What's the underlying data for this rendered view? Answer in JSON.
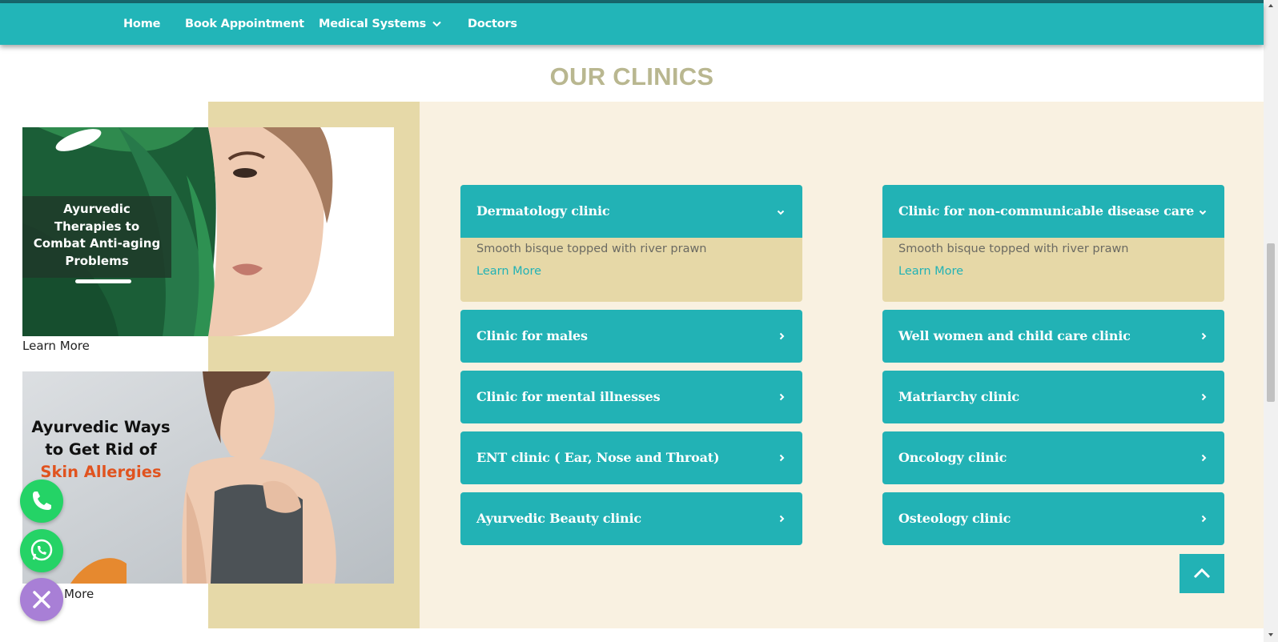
{
  "nav": {
    "items": [
      {
        "label": "Home"
      },
      {
        "label": "Book Appointment"
      },
      {
        "label": "Medical Systems"
      },
      {
        "label": "Doctors"
      }
    ]
  },
  "section_title": "OUR CLINICS",
  "cards": [
    {
      "overlay_text": [
        "Ayurvedic",
        "Therapies to",
        "Combat Anti-aging",
        "Problems"
      ],
      "link": "Learn More"
    },
    {
      "overlay_text": [
        "Ayurvedic Ways",
        "to Get Rid of",
        "Skin Allergies"
      ],
      "link": "More"
    }
  ],
  "clinics": {
    "left": [
      {
        "title": "Dermatology clinic",
        "expanded": true,
        "desc": "Smooth bisque topped with river prawn",
        "link": "Learn More"
      },
      {
        "title": "Clinic for males",
        "expanded": false
      },
      {
        "title": "Clinic for mental illnesses",
        "expanded": false
      },
      {
        "title": "ENT clinic ( Ear, Nose and Throat)",
        "expanded": false
      },
      {
        "title": "Ayurvedic Beauty clinic",
        "expanded": false
      }
    ],
    "right": [
      {
        "title": "Clinic for non-communicable disease care",
        "expanded": true,
        "desc": "Smooth bisque topped with river prawn",
        "link": "Learn More"
      },
      {
        "title": "Well women and child care clinic",
        "expanded": false
      },
      {
        "title": "Matriarchy clinic",
        "expanded": false
      },
      {
        "title": "Oncology clinic",
        "expanded": false
      },
      {
        "title": "Osteology clinic",
        "expanded": false
      }
    ]
  },
  "colors": {
    "nav_bg": "#22b5b8",
    "accordion": "#22b2b5",
    "tan": "#e6d9a8",
    "cream": "#f9f1e1",
    "title": "#b9b790",
    "skin_allergy_accent": "#e0531f"
  },
  "icons": {
    "dropdown": "chevron-down-icon",
    "accordion_collapsed": "chevron-right-icon",
    "accordion_expanded": "chevron-down-icon",
    "to_top": "arrow-up-icon",
    "phone": "phone-icon",
    "whatsapp": "whatsapp-icon",
    "close": "close-icon"
  }
}
